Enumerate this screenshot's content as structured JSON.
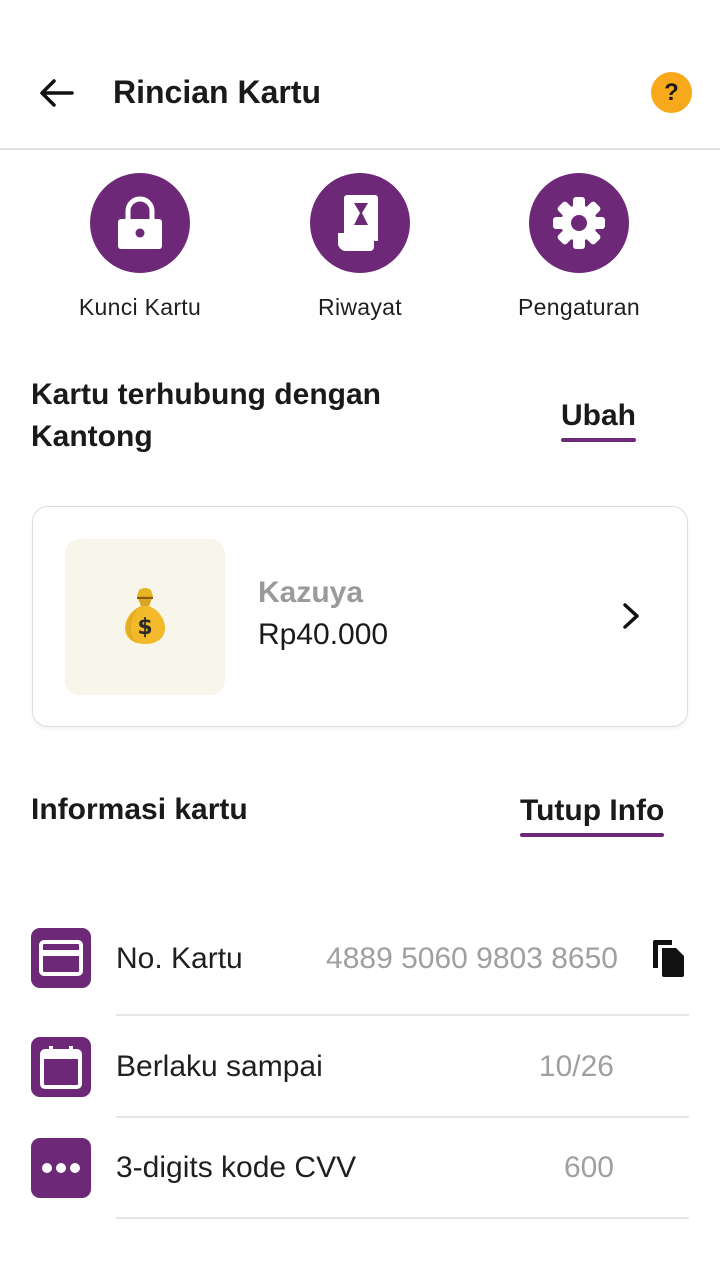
{
  "header": {
    "title": "Rincian Kartu",
    "back_icon": "arrow-left-icon",
    "help_label": "?",
    "help_color": "#f7a91b"
  },
  "actions": [
    {
      "label": "Kunci Kartu",
      "icon": "lock-icon"
    },
    {
      "label": "Riwayat",
      "icon": "history-receipt-icon"
    },
    {
      "label": "Pengaturan",
      "icon": "gear-icon"
    }
  ],
  "linked": {
    "title": "Kartu terhubung dengan Kantong",
    "change_label": "Ubah"
  },
  "pocket": {
    "icon": "money-bag-icon",
    "name": "Kazuya",
    "balance": "Rp40.000"
  },
  "card_info": {
    "title": "Informasi kartu",
    "toggle_label": "Tutup Info",
    "rows": [
      {
        "label": "No. Kartu",
        "value": "4889 5060 9803 8650",
        "icon": "credit-card-icon"
      },
      {
        "label": "Berlaku sampai",
        "value": "10/26",
        "icon": "calendar-icon"
      },
      {
        "label": "3-digits kode CVV",
        "value": "600",
        "icon": "dots-icon"
      }
    ]
  },
  "colors": {
    "accent": "#6d2877",
    "help_badge": "#f7a91b",
    "muted_text": "#a0a0a0"
  }
}
